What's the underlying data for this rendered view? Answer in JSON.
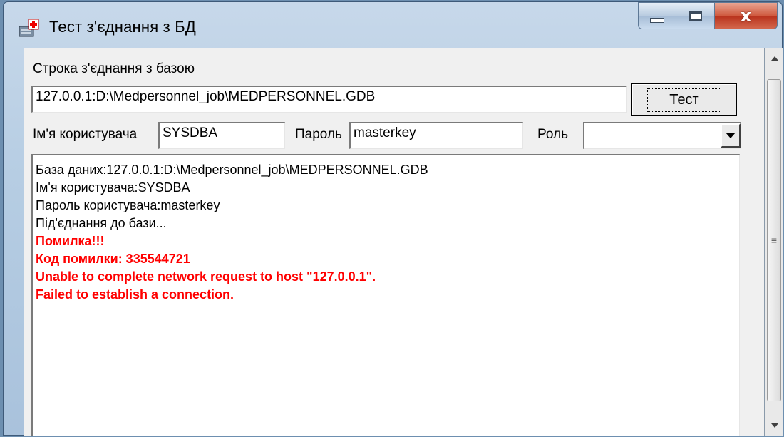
{
  "window": {
    "title": "Тест з'єднання з БД",
    "icon": "database-medical-icon",
    "caption_close": "x"
  },
  "form": {
    "connection_label": "Строка з'єднання з базою",
    "connection_value": "127.0.0.1:D:\\Medpersonnel_job\\MEDPERSONNEL.GDB",
    "test_button": "Тест",
    "user_label": "Ім'я користувача",
    "user_value": "SYSDBA",
    "password_label": "Пароль",
    "password_value": "masterkey",
    "role_label": "Роль",
    "role_value": ""
  },
  "log": {
    "lines": [
      "База даних:127.0.0.1:D:\\Medpersonnel_job\\MEDPERSONNEL.GDB",
      "Ім'я користувача:SYSDBA",
      "Пароль користувача:masterkey",
      "Під'єднання до бази..."
    ],
    "error_lines": [
      "Помилка!!!",
      "Код помилки: 335544721",
      "Unable to complete network request to host \"127.0.0.1\".",
      "Failed to establish a connection."
    ],
    "error_color": "#ff0000"
  },
  "scrollbar": {
    "grip": "≡"
  }
}
